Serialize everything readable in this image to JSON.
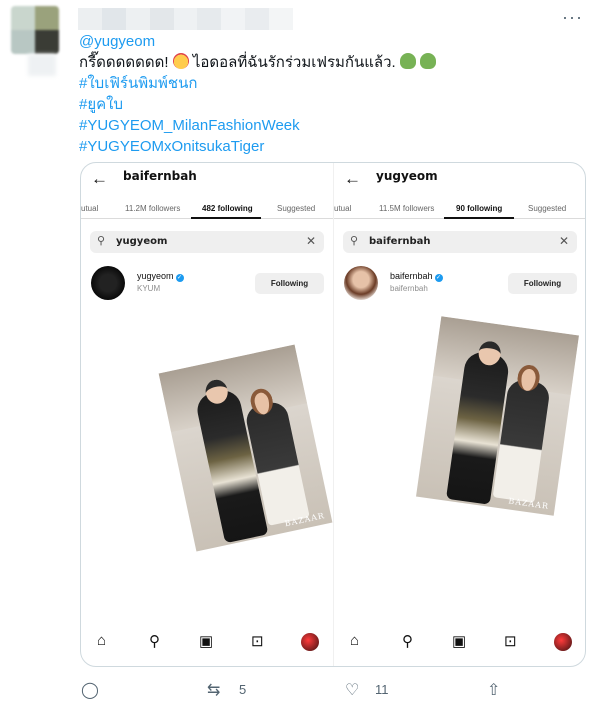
{
  "tweet": {
    "avatar_icon": "blurred-avatar",
    "more_icon": "more-dots-icon",
    "more_glyph": "···",
    "lines": [
      "@yugyeom",
      "กรี๊ดดดดดดด!",
      "ไอดอลที่ฉันรักร่วมเฟรมกันแล้ว.",
      "#ใบเฟิร์นพิมพ์ชนก",
      "#ยูคใบ",
      "#YUGYEOM_MilanFashionWeek",
      "#YUGYEOMxOnitsukaTiger"
    ],
    "colors": {
      "link": "#1d9bf0",
      "text": "#0f1419",
      "muted": "#536471",
      "border": "#cfd9de"
    }
  },
  "panels": [
    {
      "username": "baifernbah",
      "tabs": [
        "utual",
        "11.2M followers",
        "482 following",
        "Suggested"
      ],
      "active_tab": 2,
      "search_query": "yugyeom",
      "result": {
        "name": "yugyeom",
        "subtitle": "KYUM",
        "button": "Following"
      },
      "watermark": "BAZAAR"
    },
    {
      "username": "yugyeom",
      "tabs": [
        "utual",
        "11.5M followers",
        "90 following",
        "Suggested"
      ],
      "active_tab": 2,
      "search_query": "baifernbah",
      "result": {
        "name": "baifernbah",
        "subtitle": "baifernbah",
        "button": "Following"
      },
      "watermark": "BAZAAR"
    }
  ],
  "glyphs": {
    "back": "←",
    "search": "⚲",
    "clear": "✕",
    "check": "✓",
    "home": "⌂",
    "reels": "▣",
    "shop": "⊡"
  },
  "actions": {
    "replies": "",
    "retweets": "5",
    "likes": "11"
  }
}
